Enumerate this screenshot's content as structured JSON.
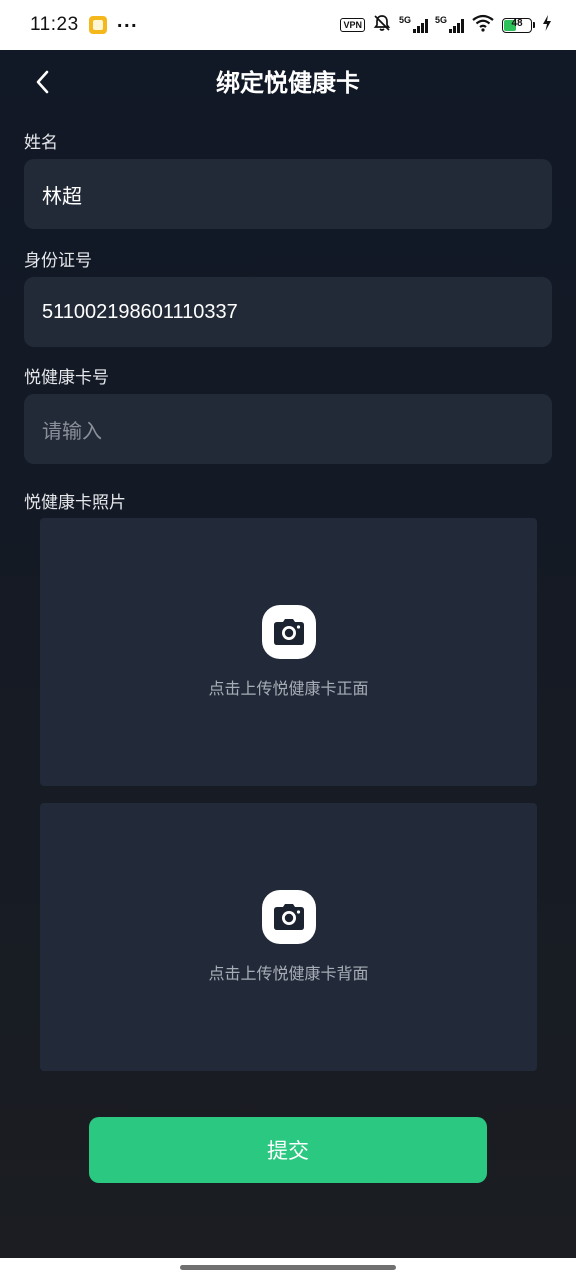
{
  "status_bar": {
    "time": "11:23",
    "vpn": "VPN",
    "signal1": "5G",
    "signal2": "5G",
    "battery": "48"
  },
  "header": {
    "title": "绑定悦健康卡"
  },
  "form": {
    "name_label": "姓名",
    "name_value": "林超",
    "id_label": "身份证号",
    "id_value": "511002198601110337",
    "card_label": "悦健康卡号",
    "card_placeholder": "请输入",
    "photo_label": "悦健康卡照片",
    "front_upload_text": "点击上传悦健康卡正面",
    "back_upload_text": "点击上传悦健康卡背面"
  },
  "actions": {
    "submit_label": "提交"
  },
  "colors": {
    "accent": "#2bc882",
    "background": "#141a24",
    "field": "#222a38"
  }
}
